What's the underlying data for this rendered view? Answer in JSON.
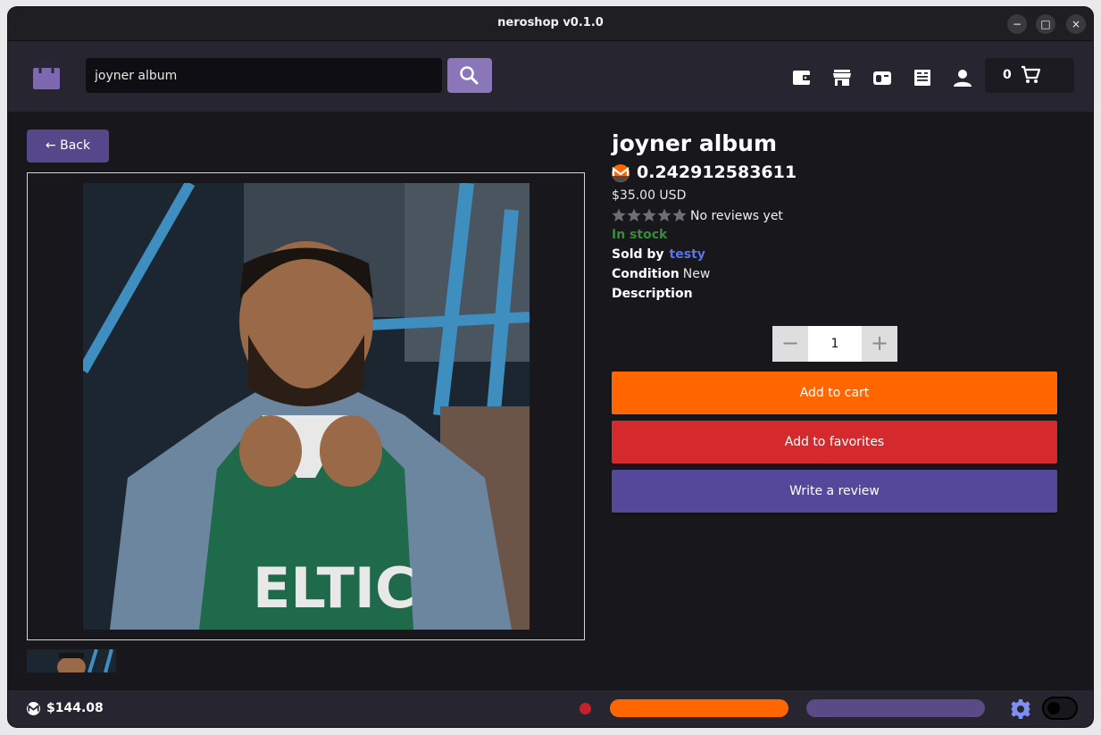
{
  "window": {
    "title": "neroshop v0.1.0",
    "controls": {
      "minimize": "−",
      "maximize": "□",
      "close": "×"
    }
  },
  "header": {
    "search": {
      "value": "joyner album",
      "placeholder": ""
    },
    "icons": [
      "wallet-icon",
      "store-icon",
      "inbox-icon",
      "orders-icon",
      "account-icon"
    ],
    "cart": {
      "count": "0"
    }
  },
  "product": {
    "back_label": "← Back",
    "title": "joyner album",
    "price_xmr": "0.242912583611",
    "price_usd": "$35.00 USD",
    "rating_stars": 0,
    "rating_max": 5,
    "reviews_text": "No reviews yet",
    "stock_status": "In stock",
    "sold_by_label": "Sold by",
    "seller": "testy",
    "condition_label": "Condition",
    "condition_value": "New",
    "description_label": "Description",
    "quantity": "1",
    "qty_minus": "−",
    "qty_plus": "+",
    "add_to_cart_label": "Add to cart",
    "add_to_favorites_label": "Add to favorites",
    "write_review_label": "Write a review"
  },
  "footer": {
    "balance": "$144.08"
  },
  "colors": {
    "accent_purple": "#55478a",
    "search_button": "#8a76b8",
    "add_to_cart": "#ff6600",
    "add_to_favorites": "#d42a2e",
    "write_review": "#55479a",
    "in_stock": "#3b8a3b",
    "seller_link": "#5b74e6",
    "sync_bar": "#ff6600",
    "daemon_bar": "#5a4a85",
    "status_dot": "#c8202a",
    "gear": "#7d8ff0"
  }
}
